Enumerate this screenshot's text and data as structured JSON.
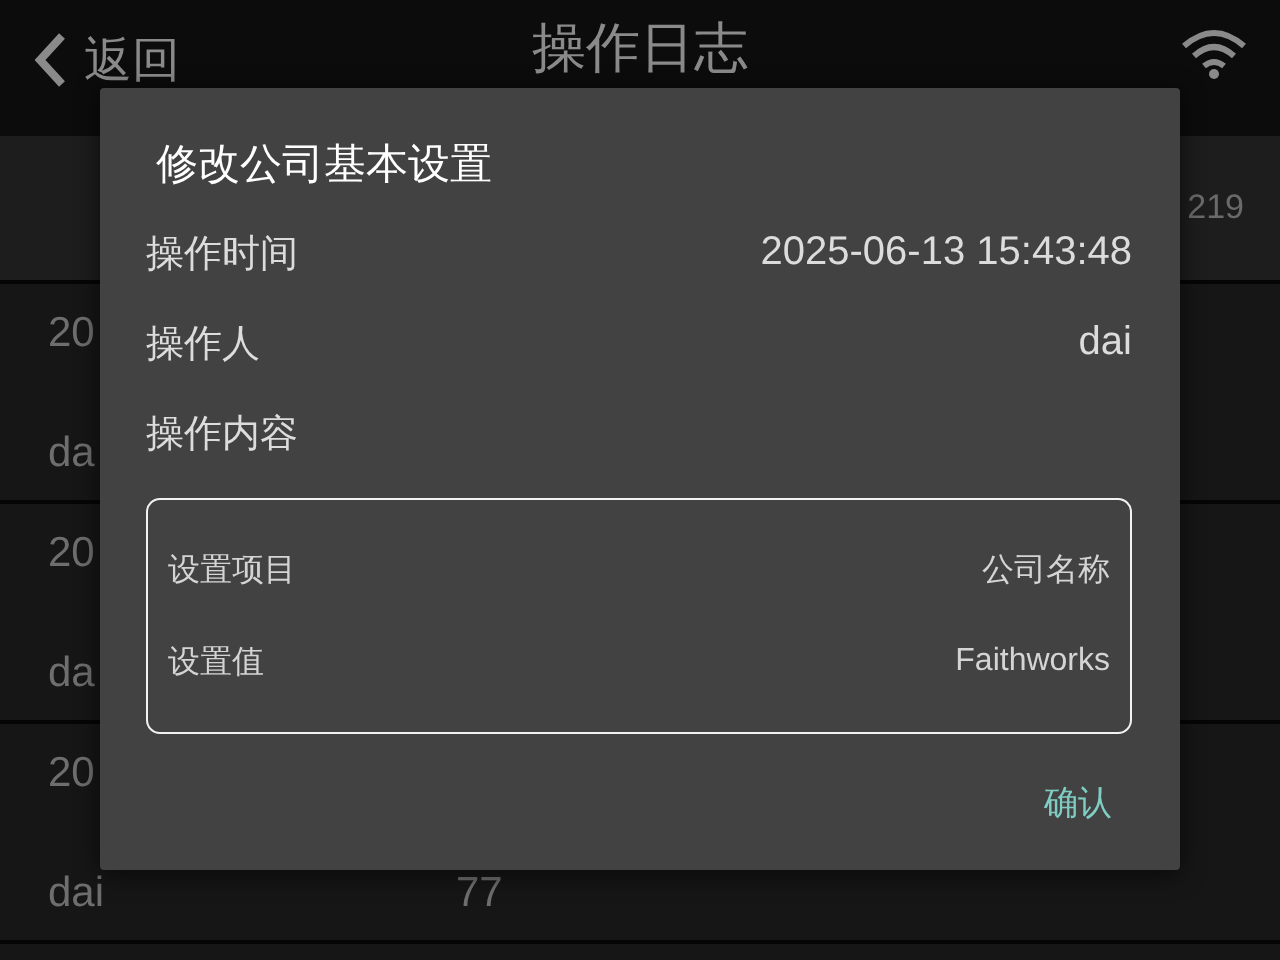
{
  "header": {
    "back_label": "返回",
    "title": "操作日志"
  },
  "summary": {
    "count": "219"
  },
  "log_rows": [
    {
      "line_1": "20",
      "line_2": "da"
    },
    {
      "line_1": "20",
      "line_2": "da"
    },
    {
      "line_1": "20",
      "line_2": "dai",
      "column_2": "77"
    }
  ],
  "dialog": {
    "title": "修改公司基本设置",
    "fields": [
      {
        "label": "操作时间",
        "value": "2025-06-13 15:43:48"
      },
      {
        "label": "操作人",
        "value": "dai"
      }
    ],
    "content_label": "操作内容",
    "details": [
      {
        "label": "设置项目",
        "value": "公司名称"
      },
      {
        "label": "设置值",
        "value": "Faithworks"
      }
    ],
    "buttons": [
      "确认"
    ]
  }
}
